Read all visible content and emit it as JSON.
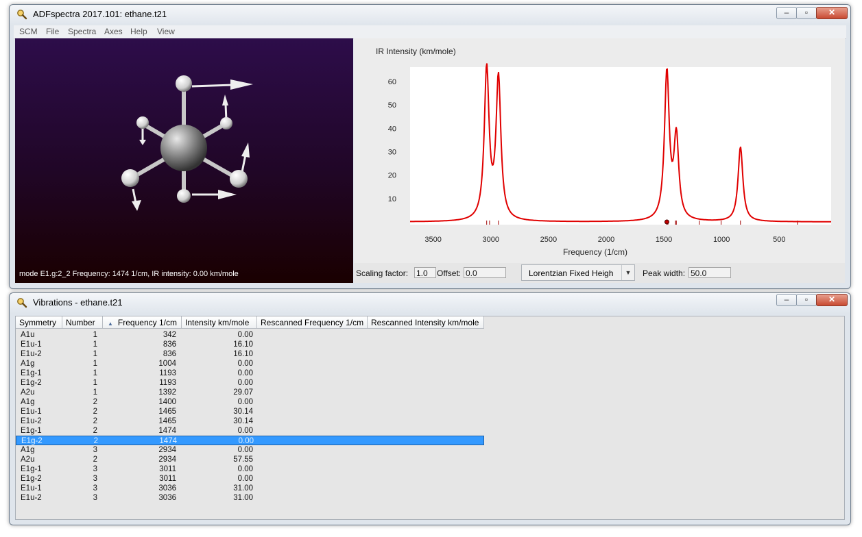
{
  "main_window": {
    "title": "ADFspectra 2017.101: ethane.t21",
    "menu": [
      "SCM",
      "File",
      "Spectra",
      "Axes",
      "Help",
      "View"
    ],
    "controls": {
      "minimize": "‒",
      "restore": "▫",
      "close": "✕"
    },
    "status_text": "mode E1.g:2_2 Frequency: 1474 1/cm, IR intensity:   0.00 km/mole"
  },
  "chart_data": {
    "type": "line",
    "title": "",
    "ylabel": "IR Intensity (km/mole)",
    "xlabel": "Frequency (1/cm)",
    "x_ticks": [
      3500,
      3000,
      2500,
      2000,
      1500,
      1000,
      500
    ],
    "y_ticks": [
      10,
      20,
      30,
      40,
      50,
      60
    ],
    "xlim": [
      3700,
      50
    ],
    "ylim": [
      0,
      65
    ],
    "series": [
      {
        "line_color": "#e00000",
        "peaks": [
          {
            "x": 3036,
            "y": 64.5
          },
          {
            "x": 2934,
            "y": 60.5
          },
          {
            "x": 1474,
            "y": 63.0
          },
          {
            "x": 1392,
            "y": 35.0
          },
          {
            "x": 836,
            "y": 32.0
          }
        ],
        "half_width": 25
      }
    ],
    "stick_markers": [
      342,
      836,
      1004,
      1193,
      1392,
      1400,
      1465,
      1474,
      2934,
      3011,
      3036
    ],
    "selected_marker": 1474
  },
  "controls": {
    "scaling_label": "Scaling factor:",
    "scaling_value": "1.0",
    "offset_label": "Offset:",
    "offset_value": "0.0",
    "lineshape_value": "Lorentzian Fixed Heigh",
    "peak_width_label": "Peak width:",
    "peak_width_value": "50.0"
  },
  "vib_window": {
    "title": "Vibrations - ethane.t21",
    "controls": {
      "minimize": "‒",
      "restore": "▫",
      "close": "✕"
    },
    "columns": [
      "Symmetry",
      "Number",
      "Frequency 1/cm",
      "Intensity km/mole",
      "Rescanned Frequency 1/cm",
      "Rescanned Intensity km/mole"
    ],
    "sort_indicator": "▲",
    "rows": [
      {
        "sym": "A1u",
        "num": "1",
        "freq": "342",
        "int": "0.00"
      },
      {
        "sym": "E1u-1",
        "num": "1",
        "freq": "836",
        "int": "16.10"
      },
      {
        "sym": "E1u-2",
        "num": "1",
        "freq": "836",
        "int": "16.10"
      },
      {
        "sym": "A1g",
        "num": "1",
        "freq": "1004",
        "int": "0.00"
      },
      {
        "sym": "E1g-1",
        "num": "1",
        "freq": "1193",
        "int": "0.00"
      },
      {
        "sym": "E1g-2",
        "num": "1",
        "freq": "1193",
        "int": "0.00"
      },
      {
        "sym": "A2u",
        "num": "1",
        "freq": "1392",
        "int": "29.07"
      },
      {
        "sym": "A1g",
        "num": "2",
        "freq": "1400",
        "int": "0.00"
      },
      {
        "sym": "E1u-1",
        "num": "2",
        "freq": "1465",
        "int": "30.14"
      },
      {
        "sym": "E1u-2",
        "num": "2",
        "freq": "1465",
        "int": "30.14"
      },
      {
        "sym": "E1g-1",
        "num": "2",
        "freq": "1474",
        "int": "0.00"
      },
      {
        "sym": "E1g-2",
        "num": "2",
        "freq": "1474",
        "int": "0.00",
        "selected": true
      },
      {
        "sym": "A1g",
        "num": "3",
        "freq": "2934",
        "int": "0.00"
      },
      {
        "sym": "A2u",
        "num": "2",
        "freq": "2934",
        "int": "57.55"
      },
      {
        "sym": "E1g-1",
        "num": "3",
        "freq": "3011",
        "int": "0.00"
      },
      {
        "sym": "E1g-2",
        "num": "3",
        "freq": "3011",
        "int": "0.00"
      },
      {
        "sym": "E1u-1",
        "num": "3",
        "freq": "3036",
        "int": "31.00"
      },
      {
        "sym": "E1u-2",
        "num": "3",
        "freq": "3036",
        "int": "31.00"
      }
    ]
  }
}
